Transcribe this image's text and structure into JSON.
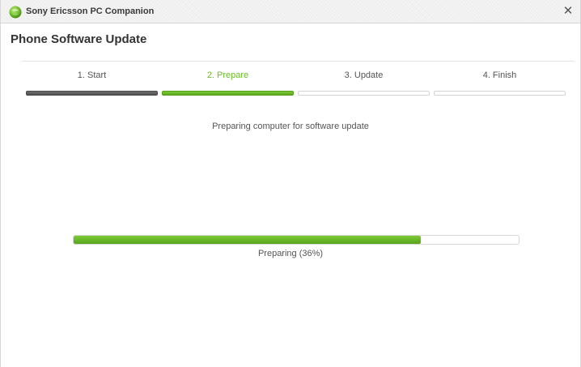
{
  "window": {
    "app_title": "Sony Ericsson PC Companion",
    "app_icon": "sony-ericsson-logo-icon",
    "close_glyph": "✕"
  },
  "page": {
    "title": "Phone Software Update"
  },
  "steps": [
    {
      "label": "1. Start",
      "state": "done"
    },
    {
      "label": "2. Prepare",
      "state": "current"
    },
    {
      "label": "3. Update",
      "state": "pending"
    },
    {
      "label": "4. Finish",
      "state": "pending"
    }
  ],
  "status": {
    "message": "Preparing computer for software update"
  },
  "progress": {
    "fill_fraction": 0.78,
    "label": "Preparing (36%)"
  },
  "colors": {
    "accent_green": "#6cba2a",
    "done_gray": "#5a5a5a"
  }
}
